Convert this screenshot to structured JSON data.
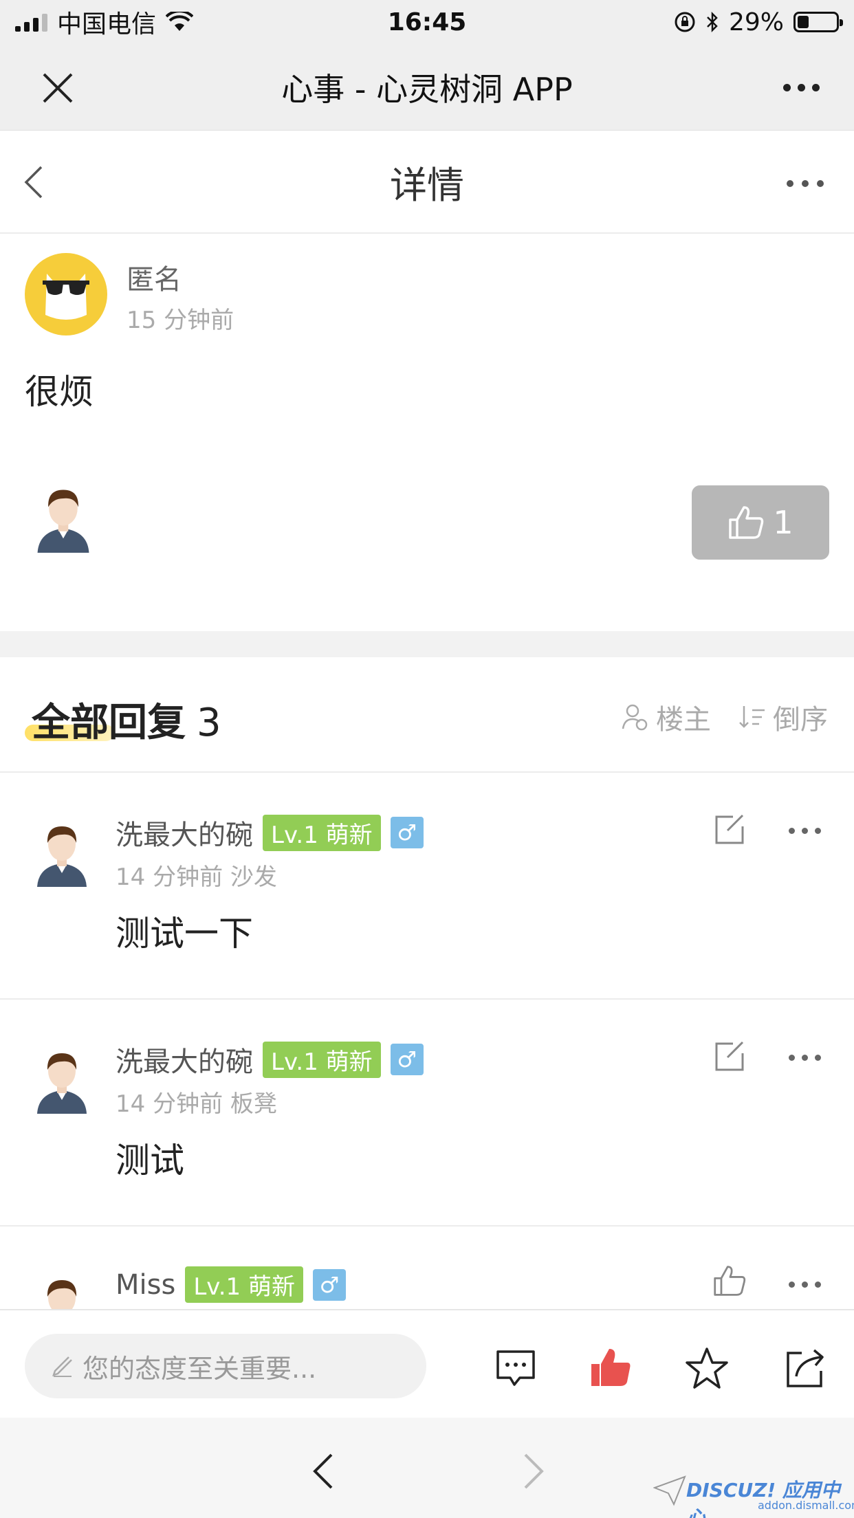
{
  "status_bar": {
    "carrier": "中国电信",
    "time": "16:45",
    "battery": "29%",
    "battery_level": 0.29
  },
  "wechat_bar": {
    "title": "心事 - 心灵树洞 APP"
  },
  "nav": {
    "title": "详情"
  },
  "post": {
    "author": "匿名",
    "time": "15 分钟前",
    "content": "很烦",
    "like_count": "1"
  },
  "replies": {
    "title": "全部回复",
    "count": "3",
    "filter_owner": "楼主",
    "sort_reverse": "倒序",
    "items": [
      {
        "name": "洗最大的碗",
        "level": "Lv.1 萌新",
        "gender": "♂",
        "time": "14 分钟前",
        "floor": "沙发",
        "text": "测试一下"
      },
      {
        "name": "洗最大的碗",
        "level": "Lv.1 萌新",
        "gender": "♂",
        "time": "14 分钟前",
        "floor": "板凳",
        "text": "测试"
      },
      {
        "name": "Miss",
        "level": "Lv.1 萌新",
        "gender": "♂"
      }
    ]
  },
  "comment_bar": {
    "placeholder": "您的态度至关重要..."
  },
  "watermark": {
    "logo": "DISCUZ! 应用中心",
    "url": "addon.dismall.com"
  },
  "colors": {
    "like_active": "#e8524f",
    "level_badge": "#92cd55",
    "gender_badge": "#7cbde8",
    "avatar_anon_bg": "#f6cd3a"
  }
}
